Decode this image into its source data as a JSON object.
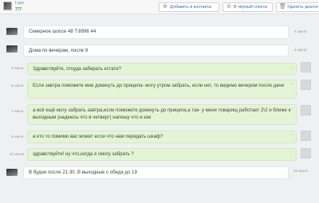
{
  "header": {
    "seller_name": "Lepo",
    "seller_count": "777",
    "buttons": {
      "add_contact": "Добавить в контакты",
      "blacklist": "В чёрный список",
      "delete_dialog": "Удалить диалог"
    }
  },
  "messages": [
    {
      "dir": "in",
      "text": "Северное шоссе 48  Т.8996              44",
      "time": "4 июня"
    },
    {
      "dir": "in",
      "text": "Дома по вечерам, после 9",
      "time": "4 июня"
    },
    {
      "dir": "out",
      "text": "Здравствуйте, откуда забирать кстати?",
      "time": "5 июня"
    },
    {
      "dir": "out",
      "text": "Если завтра поможете мне докинуть до прицепа- могу утром забрать, если нет, то видимо вечером после дачи",
      "time": "5 июня"
    },
    {
      "dir": "out",
      "text": "а всё ещё могу забрать завтра,если поможете докинуть до прицепа,а так- у меня товарищ работает 2\\2 и ближе к выходным (надеюсь что в четверг) напишу что и как",
      "time": "7 июня"
    },
    {
      "dir": "out",
      "text": "а кто то помимо вас может если что нам передать шкаф?",
      "time": "9 июня"
    },
    {
      "dir": "out",
      "text": "здравствуйте! ну что,когда я смогу забрать ?",
      "time": "22 июня"
    },
    {
      "dir": "in",
      "text": "В будни после 21:30. В выходные с обеда до 19",
      "time": "22 июня"
    }
  ],
  "colors": {
    "incoming_bg": "#ffffff",
    "outgoing_bg": "#e4f5d5",
    "link": "#3b6fb6"
  }
}
